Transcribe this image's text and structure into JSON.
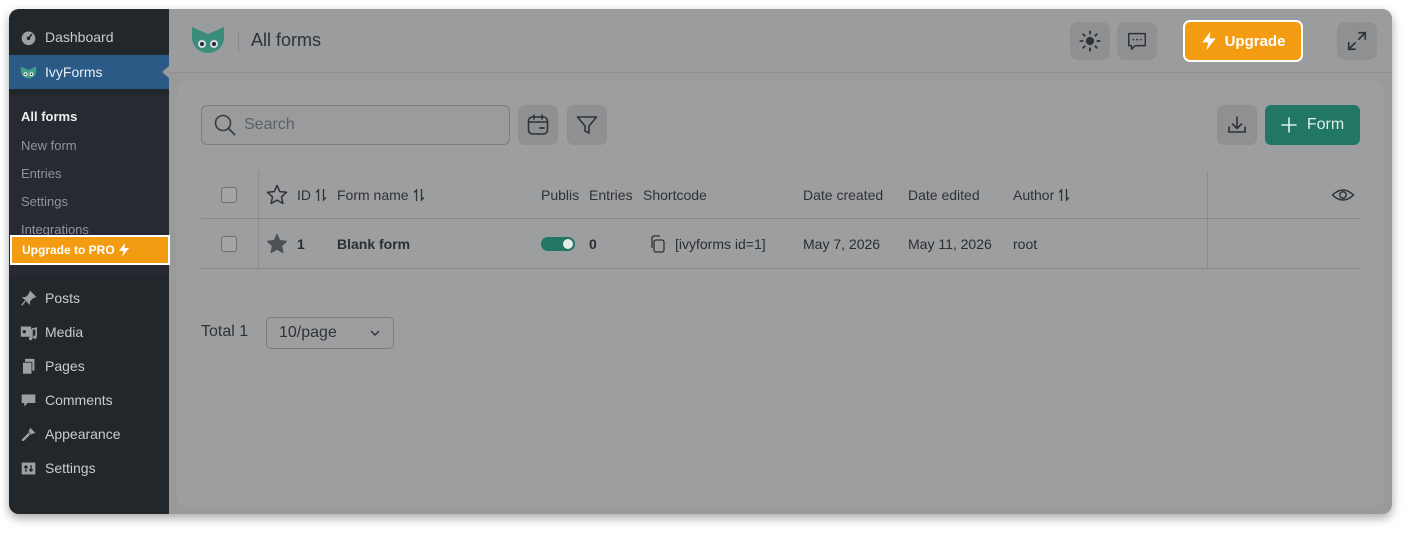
{
  "sidebar": {
    "top_items": [
      {
        "label": "Dashboard",
        "icon": "dashboard-icon"
      },
      {
        "label": "IvyForms",
        "icon": "ivyforms-logo-icon"
      }
    ],
    "submenu": [
      "All forms",
      "New form",
      "Entries",
      "Settings",
      "Integrations"
    ],
    "upgrade_label": "Upgrade to PRO",
    "bottom_items": [
      {
        "label": "Posts",
        "icon": "pin-icon"
      },
      {
        "label": "Media",
        "icon": "media-icon"
      },
      {
        "label": "Pages",
        "icon": "pages-icon"
      },
      {
        "label": "Comments",
        "icon": "comment-icon"
      },
      {
        "label": "Appearance",
        "icon": "brush-icon"
      },
      {
        "label": "Settings",
        "icon": "settings-sliders-icon"
      }
    ]
  },
  "header": {
    "title": "All forms",
    "upgrade_label": "Upgrade"
  },
  "toolbar": {
    "search_placeholder": "Search",
    "add_form_label": "Form"
  },
  "table": {
    "columns": [
      "ID",
      "Form name",
      "Publis",
      "Entries",
      "Shortcode",
      "Date created",
      "Date edited",
      "Author"
    ],
    "rows": [
      {
        "id": "1",
        "name": "Blank form",
        "published": true,
        "entries": "0",
        "shortcode": "[ivyforms id=1]",
        "created": "May 7, 2026",
        "edited": "May 11, 2026",
        "author": "root"
      }
    ]
  },
  "footer": {
    "total": "Total 1",
    "page_size": "10/page"
  },
  "colors": {
    "accent_green": "#217664",
    "upgrade_orange": "#f39c12",
    "sidebar_bg": "#22272c",
    "sidebar_active": "#2a5a85"
  }
}
